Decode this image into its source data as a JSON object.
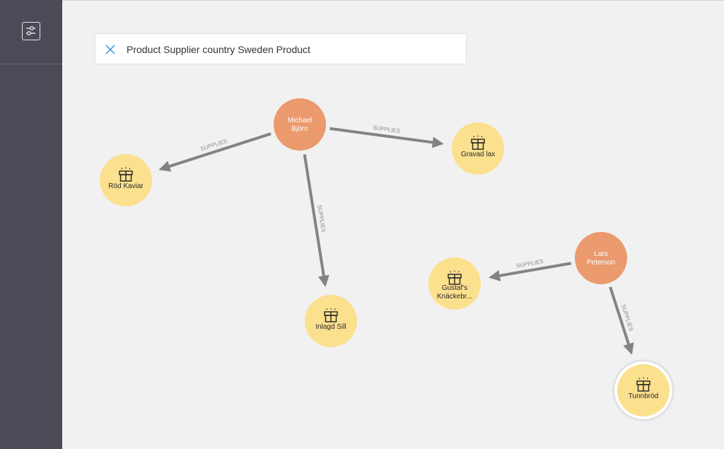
{
  "search": {
    "query": "Product Supplier country Sweden Product"
  },
  "colors": {
    "sidebar": "#4b4a57",
    "canvas": "#f1f1f1",
    "supplier_node": "#eb9a6e",
    "product_node": "#fbe08e",
    "edge": "#838383",
    "clear_icon": "#4a9fd8"
  },
  "icons": {
    "sidebar_button": "sliders-icon",
    "product": "gift-icon",
    "clear": "close-icon"
  },
  "graph": {
    "nodes": [
      {
        "id": "michael",
        "type": "supplier",
        "label_lines": [
          "Michael",
          "Björn"
        ]
      },
      {
        "id": "lars",
        "type": "supplier",
        "label_lines": [
          "Lars",
          "Peterson"
        ]
      },
      {
        "id": "rod_kaviar",
        "type": "product",
        "label_lines": [
          "Röd Kaviar"
        ]
      },
      {
        "id": "gravad_lax",
        "type": "product",
        "label_lines": [
          "Gravad lax"
        ]
      },
      {
        "id": "inlagd_sill",
        "type": "product",
        "label_lines": [
          "Inlagd Sill"
        ]
      },
      {
        "id": "gustafs",
        "type": "product",
        "label_lines": [
          "Gustaf's",
          "Knäckebr..."
        ]
      },
      {
        "id": "tunnbrod",
        "type": "product",
        "label_lines": [
          "Tunnbröd"
        ],
        "selected": true
      }
    ],
    "edges": [
      {
        "from": "michael",
        "to": "rod_kaviar",
        "label": "SUPPLIES"
      },
      {
        "from": "michael",
        "to": "gravad_lax",
        "label": "SUPPLIES"
      },
      {
        "from": "michael",
        "to": "inlagd_sill",
        "label": "SUPPLIES"
      },
      {
        "from": "lars",
        "to": "gustafs",
        "label": "SUPPLIES"
      },
      {
        "from": "lars",
        "to": "tunnbrod",
        "label": "SUPPLIES"
      }
    ]
  }
}
